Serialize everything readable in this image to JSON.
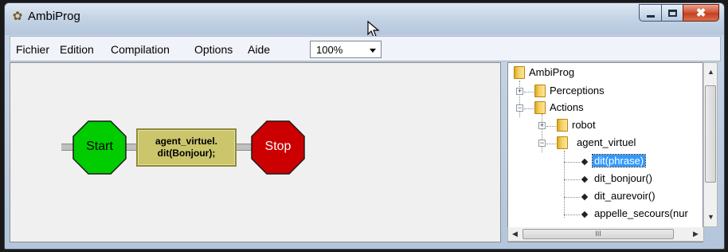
{
  "window": {
    "title": "AmbiProg",
    "icon": "ambiprog-logo-icon",
    "controls": {
      "minimize": "minimize-icon",
      "maximize": "maximize-icon",
      "close": "close-icon"
    }
  },
  "menu": {
    "items": [
      "Fichier",
      "Edition",
      "Compilation",
      "Options",
      "Aide"
    ],
    "zoom": "100%"
  },
  "program": {
    "start_label": "Start",
    "action_line1": "agent_virtuel.",
    "action_line2": "dit(Bonjour);",
    "stop_label": "Stop",
    "colors": {
      "start": "#00cc00",
      "stop": "#cc0000",
      "action": "#cbc56c"
    }
  },
  "tree": {
    "root": "AmbiProg",
    "perceptions": "Perceptions",
    "actions": "Actions",
    "robot": "robot",
    "agent_virtuel": "agent_virtuel",
    "methods": [
      "dit(phrase)",
      "dit_bonjour()",
      "dit_aurevoir()",
      "appelle_secours(nur"
    ],
    "selected_index": 0
  },
  "scrollbars": {
    "hthumb_glyph": "III"
  }
}
